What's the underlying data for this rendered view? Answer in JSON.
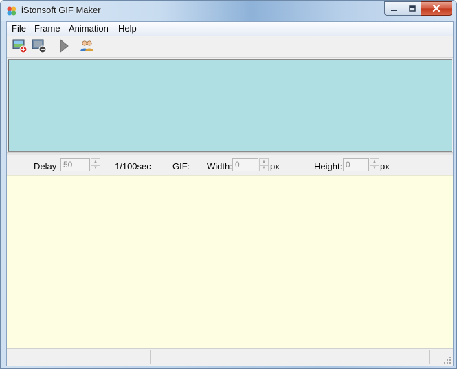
{
  "window": {
    "title": "iStonsoft GIF Maker"
  },
  "icons": {
    "app": "gif-maker-app-icon",
    "minimize": "minimize-icon",
    "maximize": "maximize-icon",
    "close": "close-icon"
  },
  "menu": {
    "items": [
      {
        "label": "File"
      },
      {
        "label": "Frame"
      },
      {
        "label": "Animation"
      },
      {
        "label": "Help"
      }
    ]
  },
  "toolbar": {
    "buttons": [
      {
        "icon": "add-image-icon"
      },
      {
        "icon": "remove-image-icon"
      },
      {
        "icon": "play-icon"
      },
      {
        "icon": "users-icon"
      }
    ]
  },
  "settings": {
    "delay_label": "Delay :",
    "delay_value": "50",
    "delay_unit": "1/100sec",
    "gif_label": "GIF:",
    "width_label": "Width:",
    "width_value": "0",
    "width_unit": "px",
    "height_label": "Height:",
    "height_value": "0",
    "height_unit": "px"
  },
  "status": {
    "pane1": "",
    "pane2": ""
  },
  "colors": {
    "frames_panel_bg": "#b0dfe3",
    "preview_bg": "#fefee2",
    "close_button": "#c94a2e"
  }
}
